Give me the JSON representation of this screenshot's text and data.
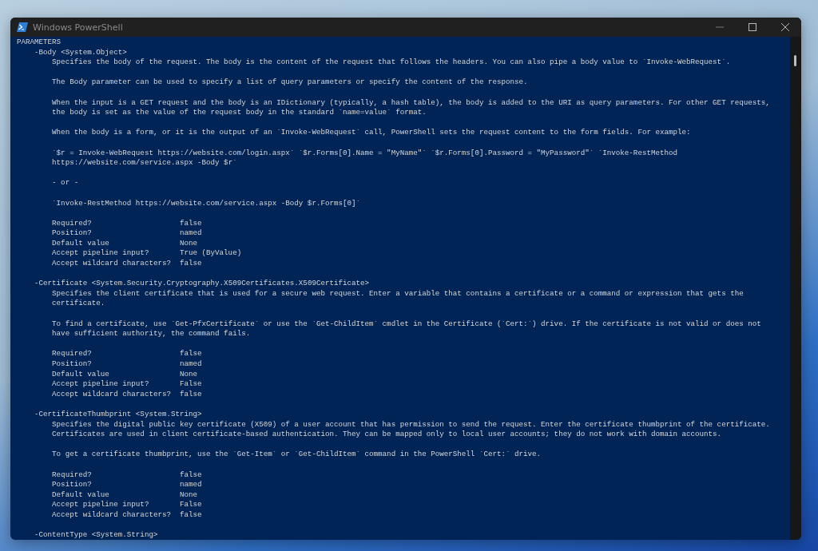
{
  "window": {
    "title": "Windows PowerShell"
  },
  "console": {
    "heading": "PARAMETERS",
    "parameters": [
      {
        "signature": "-Body <System.Object>",
        "paragraphs": [
          {
            "lines": [
              "Specifies the body of the request. The body is the content of the request that follows the headers. You can also pipe a body value to `Invoke-WebRequest`."
            ]
          },
          {
            "lines": [
              "The Body parameter can be used to specify a list of query parameters or specify the content of the response."
            ]
          },
          {
            "lines": [
              "When the input is a GET request and the body is an IDictionary (typically, a hash table), the body is added to the URI as query parameters. For other GET requests,",
              "the body is set as the value of the request body in the standard `name=value` format."
            ]
          },
          {
            "lines": [
              "When the body is a form, or it is the output of an `Invoke-WebRequest` call, PowerShell sets the request content to the form fields. For example:"
            ]
          },
          {
            "lines": [
              "`$r = Invoke-WebRequest https://website.com/login.aspx` `$r.Forms[0].Name = \"MyName\"` `$r.Forms[0].Password = \"MyPassword\"` `Invoke-RestMethod",
              "https://website.com/service.aspx -Body $r`"
            ]
          },
          {
            "lines": [
              "- or -"
            ]
          },
          {
            "lines": [
              "`Invoke-RestMethod https://website.com/service.aspx -Body $r.Forms[0]`"
            ]
          }
        ],
        "properties": [
          {
            "name": "Required?",
            "value": "false"
          },
          {
            "name": "Position?",
            "value": "named"
          },
          {
            "name": "Default value",
            "value": "None"
          },
          {
            "name": "Accept pipeline input?",
            "value": "True (ByValue)"
          },
          {
            "name": "Accept wildcard characters?",
            "value": "false"
          }
        ]
      },
      {
        "signature": "-Certificate <System.Security.Cryptography.X509Certificates.X509Certificate>",
        "paragraphs": [
          {
            "lines": [
              "Specifies the client certificate that is used for a secure web request. Enter a variable that contains a certificate or a command or expression that gets the",
              "certificate."
            ]
          },
          {
            "lines": [
              "To find a certificate, use `Get-PfxCertificate` or use the `Get-ChildItem` cmdlet in the Certificate (`Cert:`) drive. If the certificate is not valid or does not",
              "have sufficient authority, the command fails."
            ]
          }
        ],
        "properties": [
          {
            "name": "Required?",
            "value": "false"
          },
          {
            "name": "Position?",
            "value": "named"
          },
          {
            "name": "Default value",
            "value": "None"
          },
          {
            "name": "Accept pipeline input?",
            "value": "False"
          },
          {
            "name": "Accept wildcard characters?",
            "value": "false"
          }
        ]
      },
      {
        "signature": "-CertificateThumbprint <System.String>",
        "paragraphs": [
          {
            "lines": [
              "Specifies the digital public key certificate (X509) of a user account that has permission to send the request. Enter the certificate thumbprint of the certificate.",
              "Certificates are used in client certificate-based authentication. They can be mapped only to local user accounts; they do not work with domain accounts."
            ]
          },
          {
            "lines": [
              "To get a certificate thumbprint, use the `Get-Item` or `Get-ChildItem` command in the PowerShell `Cert:` drive."
            ]
          }
        ],
        "properties": [
          {
            "name": "Required?",
            "value": "false"
          },
          {
            "name": "Position?",
            "value": "named"
          },
          {
            "name": "Default value",
            "value": "None"
          },
          {
            "name": "Accept pipeline input?",
            "value": "False"
          },
          {
            "name": "Accept wildcard characters?",
            "value": "false"
          }
        ]
      },
      {
        "signature": "-ContentType <System.String>"
      }
    ]
  }
}
